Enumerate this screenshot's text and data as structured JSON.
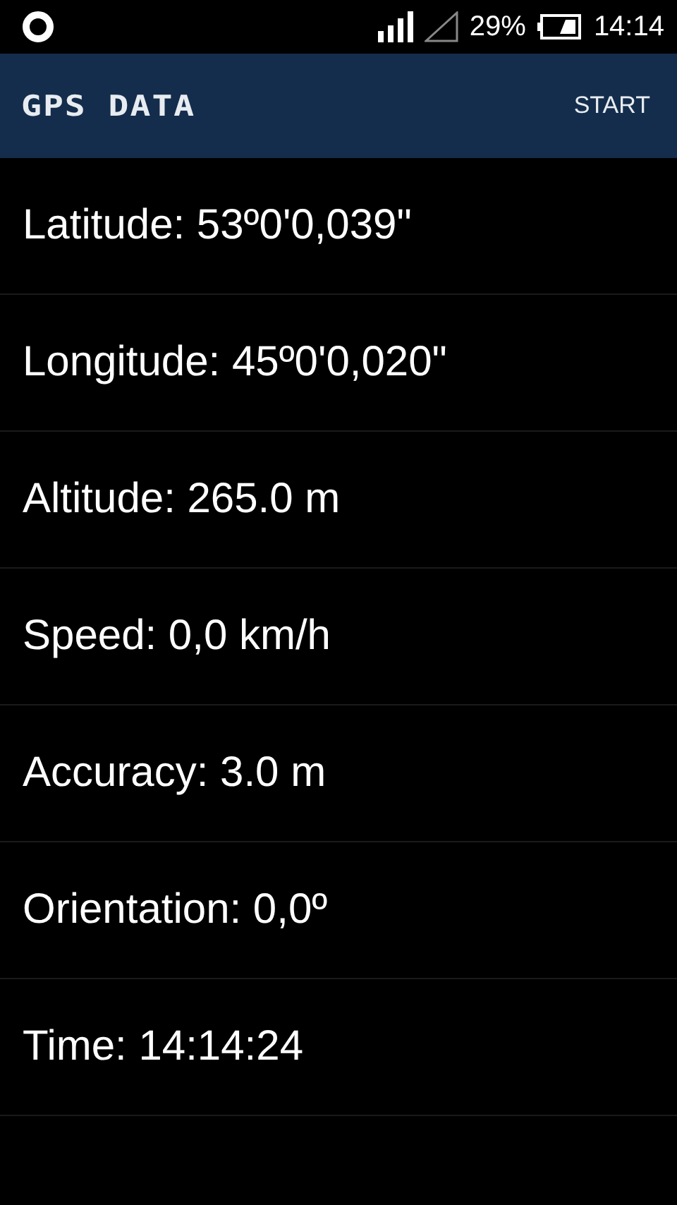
{
  "status_bar": {
    "battery": "29%",
    "time": "14:14"
  },
  "app_bar": {
    "title": "GPS DATA",
    "action": "START"
  },
  "rows": [
    {
      "text": "Latitude: 53º0'0,039\""
    },
    {
      "text": "Longitude: 45º0'0,020\""
    },
    {
      "text": "Altitude: 265.0 m"
    },
    {
      "text": "Speed: 0,0 km/h"
    },
    {
      "text": "Accuracy: 3.0 m"
    },
    {
      "text": "Orientation: 0,0º"
    },
    {
      "text": "Time: 14:14:24"
    }
  ]
}
